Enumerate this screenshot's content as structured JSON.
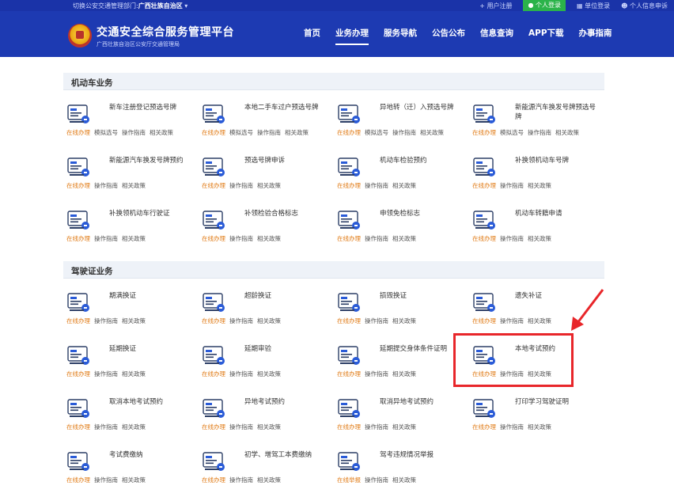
{
  "topbar": {
    "region_prefix": "切换公安交通管理部门:",
    "region_name": "广西壮族自治区",
    "user_register": "用户注册",
    "personal_login": "个人登录",
    "unit_login": "单位登录",
    "personal_info": "个人信息申诉"
  },
  "header": {
    "title": "交通安全综合服务管理平台",
    "subtitle": "广西壮族自治区公安厅交通管理局",
    "nav": [
      "首页",
      "业务办理",
      "服务导航",
      "公告公布",
      "信息查询",
      "APP下载",
      "办事指南"
    ]
  },
  "sections": [
    {
      "title": "机动车业务",
      "items": [
        {
          "label": "新车注册登记预选号牌",
          "actions": [
            "在线办理",
            "模拟选号",
            "操作指南",
            "相关政策"
          ],
          "icon": "car-registration-icon"
        },
        {
          "label": "本地二手车过户预选号牌",
          "actions": [
            "在线办理",
            "模拟选号",
            "操作指南",
            "相关政策"
          ],
          "icon": "car-transfer-icon"
        },
        {
          "label": "异地转（迁）入预选号牌",
          "actions": [
            "在线办理",
            "模拟选号",
            "操作指南",
            "相关政策"
          ],
          "icon": "car-migrate-icon"
        },
        {
          "label": "新能源汽车换发号牌预选号牌",
          "actions": [
            "在线办理",
            "模拟选号",
            "操作指南",
            "相关政策"
          ],
          "icon": "ev-plate-icon"
        },
        {
          "label": "新能源汽车换发号牌预约",
          "actions": [
            "在线办理",
            "操作指南",
            "相关政策"
          ],
          "icon": "ev-plate-appointment-icon"
        },
        {
          "label": "预选号牌申诉",
          "actions": [
            "在线办理",
            "操作指南",
            "相关政策"
          ],
          "icon": "plate-appeal-icon"
        },
        {
          "label": "机动车检验预约",
          "actions": [
            "在线办理",
            "操作指南",
            "相关政策"
          ],
          "icon": "vehicle-inspection-icon"
        },
        {
          "label": "补换领机动车号牌",
          "actions": [
            "在线办理",
            "操作指南",
            "相关政策"
          ],
          "icon": "plate-replace-icon"
        },
        {
          "label": "补换领机动车行驶证",
          "actions": [
            "在线办理",
            "操作指南",
            "相关政策"
          ],
          "icon": "vehicle-license-icon"
        },
        {
          "label": "补领检验合格标志",
          "actions": [
            "在线办理",
            "操作指南",
            "相关政策"
          ],
          "icon": "inspection-mark-icon"
        },
        {
          "label": "申领免检标志",
          "actions": [
            "在线办理",
            "操作指南",
            "相关政策"
          ],
          "icon": "exempt-mark-icon"
        },
        {
          "label": "机动车转籍申请",
          "actions": [
            "在线办理",
            "操作指南",
            "相关政策"
          ],
          "icon": "vehicle-transfer-icon"
        }
      ]
    },
    {
      "title": "驾驶证业务",
      "items": [
        {
          "label": "期满换证",
          "actions": [
            "在线办理",
            "操作指南",
            "相关政策"
          ],
          "icon": "license-renew-icon"
        },
        {
          "label": "超龄换证",
          "actions": [
            "在线办理",
            "操作指南",
            "相关政策"
          ],
          "icon": "license-overage-icon"
        },
        {
          "label": "损毁换证",
          "actions": [
            "在线办理",
            "操作指南",
            "相关政策"
          ],
          "icon": "license-damaged-icon"
        },
        {
          "label": "遗失补证",
          "actions": [
            "在线办理",
            "操作指南",
            "相关政策"
          ],
          "icon": "license-lost-icon"
        },
        {
          "label": "延期换证",
          "actions": [
            "在线办理",
            "操作指南",
            "相关政策"
          ],
          "icon": "license-delay-icon"
        },
        {
          "label": "延期审验",
          "actions": [
            "在线办理",
            "操作指南",
            "相关政策"
          ],
          "icon": "review-delay-icon"
        },
        {
          "label": "延期提交身体条件证明",
          "actions": [
            "在线办理",
            "操作指南",
            "相关政策"
          ],
          "icon": "health-proof-icon"
        },
        {
          "label": "本地考试预约",
          "actions": [
            "在线办理",
            "操作指南",
            "相关政策"
          ],
          "icon": "exam-appointment-icon"
        },
        {
          "label": "取消本地考试预约",
          "actions": [
            "在线办理",
            "操作指南",
            "相关政策"
          ],
          "icon": "cancel-exam-icon"
        },
        {
          "label": "异地考试预约",
          "actions": [
            "在线办理",
            "操作指南",
            "相关政策"
          ],
          "icon": "remote-exam-icon"
        },
        {
          "label": "取消异地考试预约",
          "actions": [
            "在线办理",
            "操作指南",
            "相关政策"
          ],
          "icon": "cancel-remote-exam-icon"
        },
        {
          "label": "打印学习驾驶证明",
          "actions": [
            "在线办理",
            "操作指南",
            "相关政策"
          ],
          "icon": "print-learner-icon"
        },
        {
          "label": "考试费缴纳",
          "actions": [
            "在线办理",
            "操作指南",
            "相关政策"
          ],
          "icon": "exam-fee-icon"
        },
        {
          "label": "初学、增驾工本费缴纳",
          "actions": [
            "在线办理",
            "操作指南",
            "相关政策"
          ],
          "icon": "license-fee-icon"
        },
        {
          "label": "驾考违规情况举报",
          "actions": [
            "在线举报",
            "操作指南",
            "相关政策"
          ],
          "icon": "violation-report-icon"
        }
      ]
    }
  ],
  "colors": {
    "header_blue": "#1d3ab2",
    "action_orange": "#e07a14",
    "highlight_red": "#e8262a",
    "icon_blue": "#2a5bd7"
  }
}
